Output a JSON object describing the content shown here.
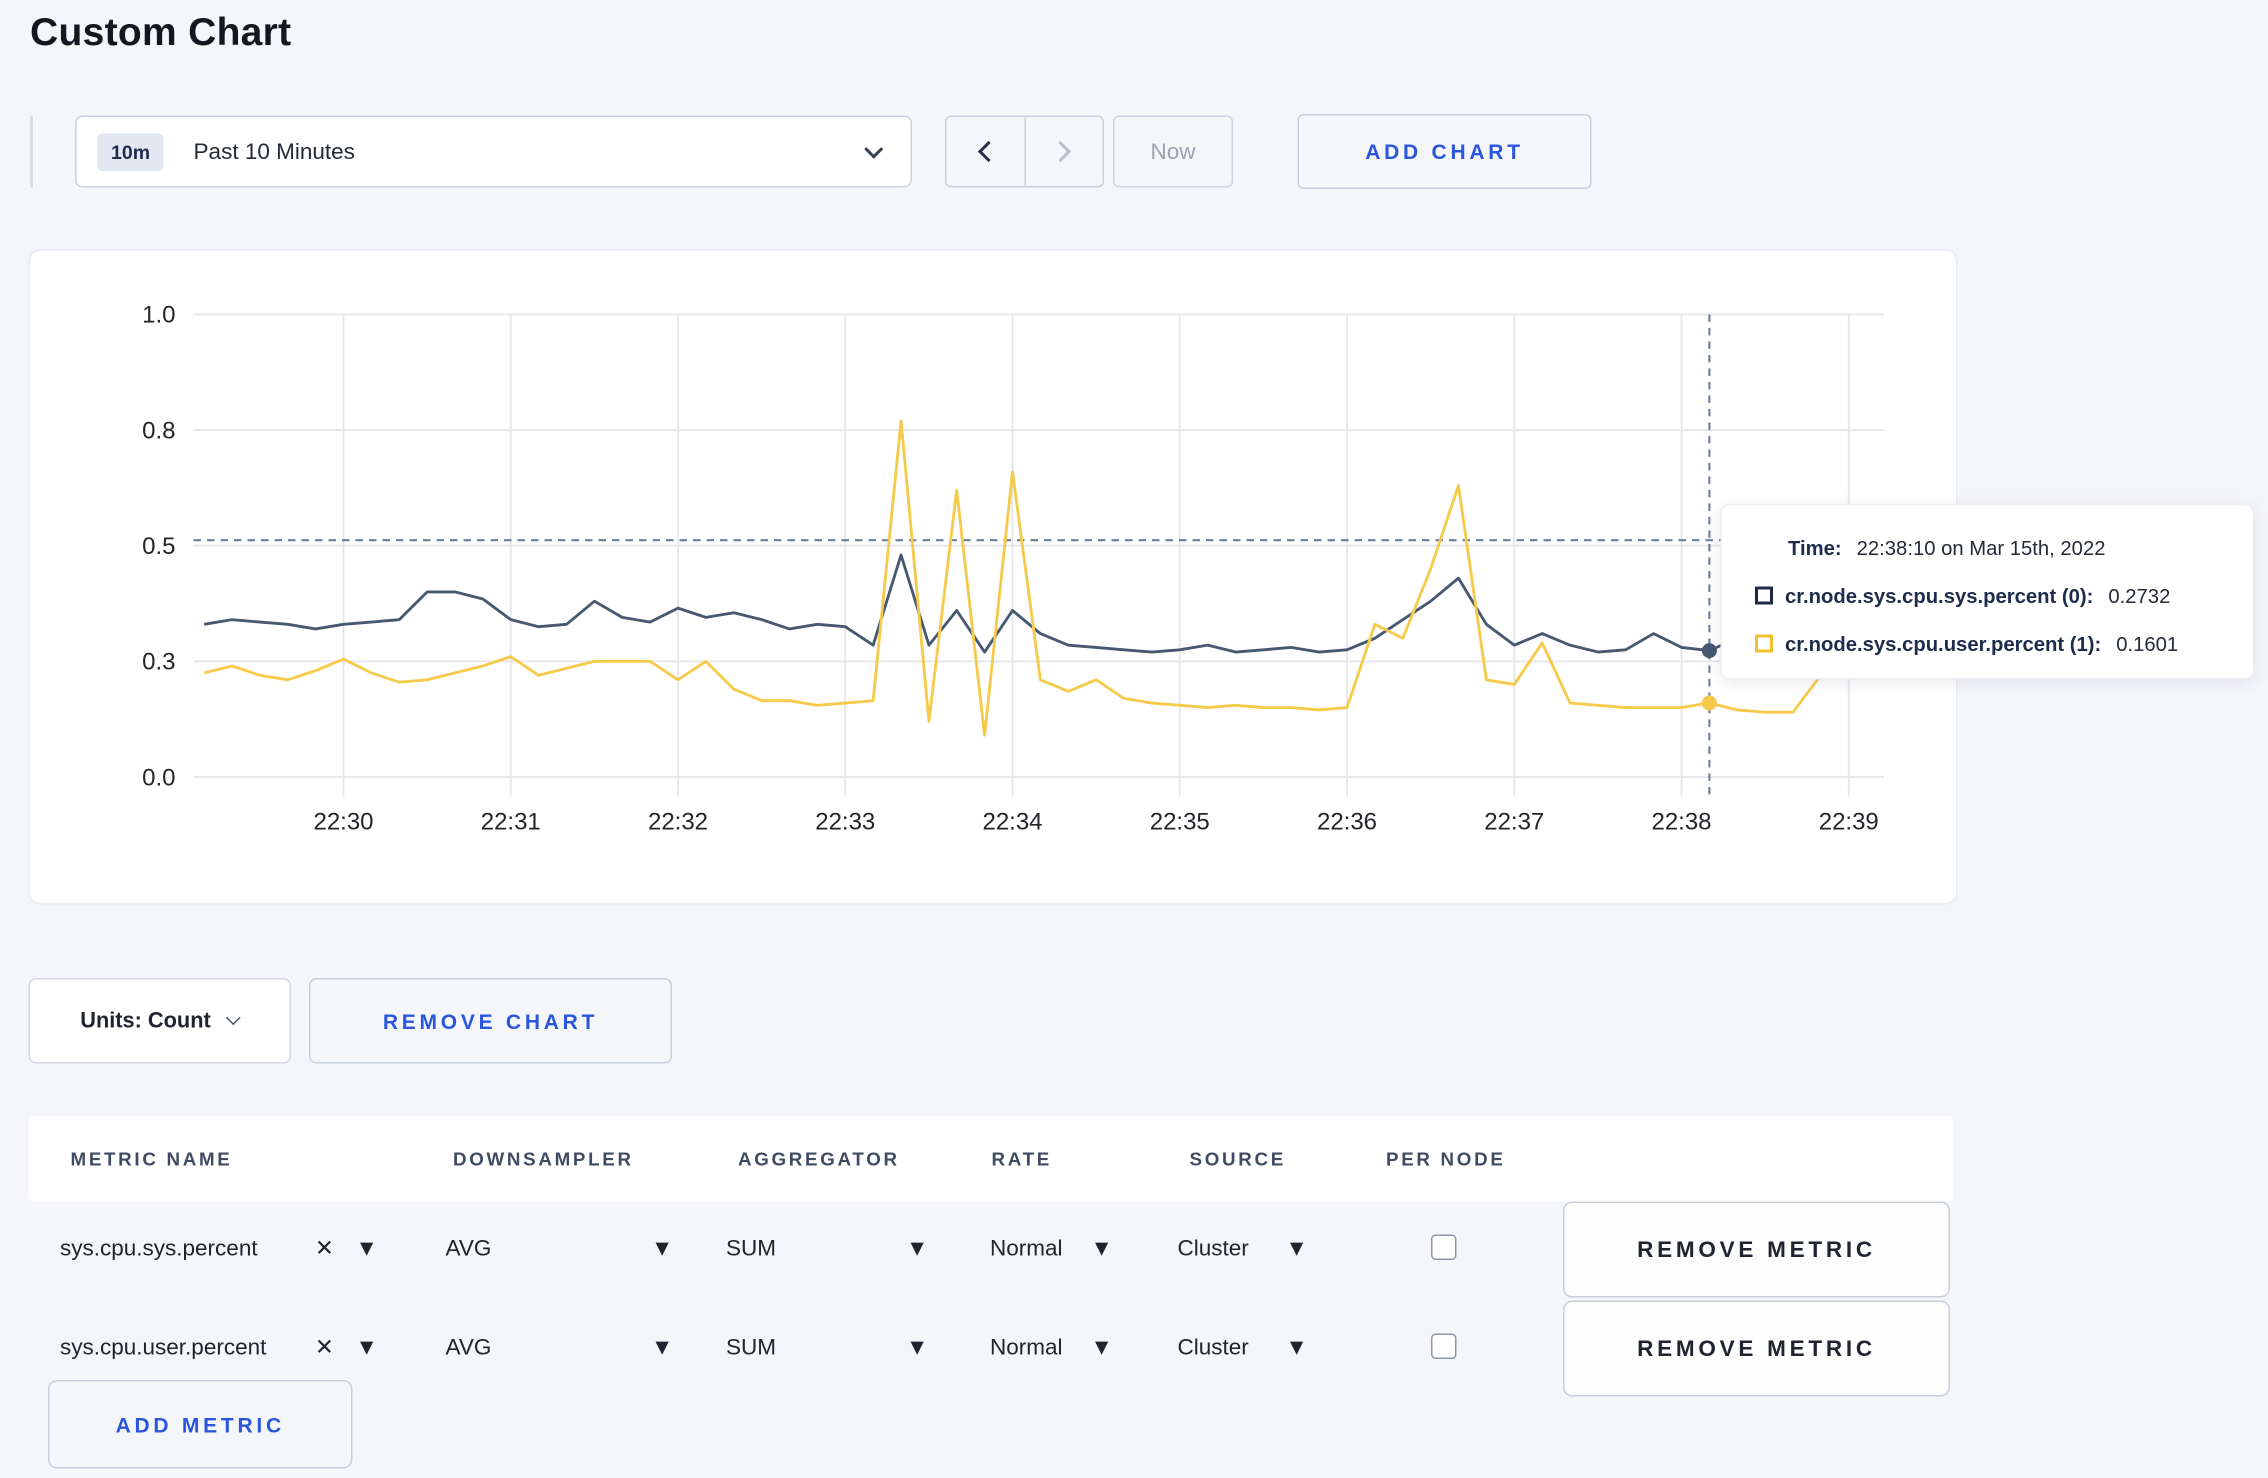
{
  "page": {
    "title": "Custom Chart",
    "background": "#f5f6fa",
    "accent_blue": "#2a56dd"
  },
  "toolbar": {
    "time_badge": "10m",
    "time_label": "Past 10 Minutes",
    "now_label": "Now",
    "add_chart_label": "ADD CHART"
  },
  "chart_data": {
    "type": "line",
    "title": "",
    "xlabel": "",
    "ylabel": "",
    "ylim": [
      0,
      1
    ],
    "grid": true,
    "x_ticks": [
      "22:30",
      "22:31",
      "22:32",
      "22:33",
      "22:34",
      "22:35",
      "22:36",
      "22:37",
      "22:38",
      "22:39"
    ],
    "y_ticks": [
      {
        "label": "0.0",
        "value": 0
      },
      {
        "label": "0.3",
        "value": 0.25
      },
      {
        "label": "0.5",
        "value": 0.5
      },
      {
        "label": "0.8",
        "value": 0.75
      },
      {
        "label": "1.0",
        "value": 1
      }
    ],
    "x_start": "22:29:10",
    "x_interval_seconds": 10,
    "series": [
      {
        "name": "cr.node.sys.cpu.sys.percent (0)",
        "color": "#475872",
        "values": [
          0.33,
          0.34,
          0.335,
          0.33,
          0.32,
          0.33,
          0.335,
          0.34,
          0.4,
          0.4,
          0.385,
          0.34,
          0.325,
          0.33,
          0.38,
          0.345,
          0.335,
          0.365,
          0.345,
          0.355,
          0.34,
          0.32,
          0.33,
          0.325,
          0.285,
          0.48,
          0.285,
          0.36,
          0.27,
          0.36,
          0.31,
          0.285,
          0.28,
          0.275,
          0.27,
          0.275,
          0.285,
          0.27,
          0.275,
          0.28,
          0.27,
          0.275,
          0.3,
          0.34,
          0.38,
          0.43,
          0.33,
          0.285,
          0.31,
          0.285,
          0.27,
          0.275,
          0.31,
          0.28,
          0.2732,
          0.3,
          0.28,
          0.275,
          0.28,
          0.3,
          0.29,
          0.27
        ]
      },
      {
        "name": "cr.node.sys.cpu.user.percent (1)",
        "color": "#f6cb4c",
        "values": [
          0.225,
          0.24,
          0.22,
          0.21,
          0.23,
          0.255,
          0.225,
          0.205,
          0.21,
          0.225,
          0.24,
          0.26,
          0.22,
          0.235,
          0.25,
          0.25,
          0.25,
          0.21,
          0.25,
          0.19,
          0.165,
          0.165,
          0.155,
          0.16,
          0.165,
          0.77,
          0.12,
          0.62,
          0.09,
          0.66,
          0.21,
          0.185,
          0.21,
          0.17,
          0.16,
          0.155,
          0.15,
          0.155,
          0.15,
          0.15,
          0.145,
          0.15,
          0.33,
          0.3,
          0.45,
          0.63,
          0.21,
          0.2,
          0.29,
          0.16,
          0.155,
          0.15,
          0.15,
          0.15,
          0.1601,
          0.145,
          0.14,
          0.14,
          0.22,
          0.3,
          0.3,
          0.24
        ]
      }
    ],
    "crosshair": {
      "x_time": "22:38:10",
      "hline_value": 0.512,
      "point_values": [
        0.2732,
        0.1601
      ],
      "color": "#6b7f99"
    },
    "gridline_color": "#e5e6e9",
    "tick_text_color": "#23252a"
  },
  "tooltip": {
    "time_label": "Time:",
    "time_value": "22:38:10 on Mar 15th, 2022",
    "series": [
      {
        "name": "cr.node.sys.cpu.sys.percent (0):",
        "value": "0.2732",
        "color": "#1c2b4a"
      },
      {
        "name": "cr.node.sys.cpu.user.percent (1):",
        "value": "0.1601",
        "color": "#f2c12e"
      }
    ]
  },
  "chart_controls": {
    "units_label": "Units: Count",
    "remove_chart_label": "REMOVE CHART"
  },
  "metrics_table": {
    "headers": [
      "METRIC NAME",
      "DOWNSAMPLER",
      "AGGREGATOR",
      "RATE",
      "SOURCE",
      "PER NODE"
    ],
    "rows": [
      {
        "metric": "sys.cpu.sys.percent",
        "downsampler": "AVG",
        "aggregator": "SUM",
        "rate": "Normal",
        "source": "Cluster",
        "per_node_checked": false,
        "remove_label": "REMOVE METRIC"
      },
      {
        "metric": "sys.cpu.user.percent",
        "downsampler": "AVG",
        "aggregator": "SUM",
        "rate": "Normal",
        "source": "Cluster",
        "per_node_checked": false,
        "remove_label": "REMOVE METRIC"
      }
    ],
    "add_metric_label": "ADD METRIC"
  }
}
